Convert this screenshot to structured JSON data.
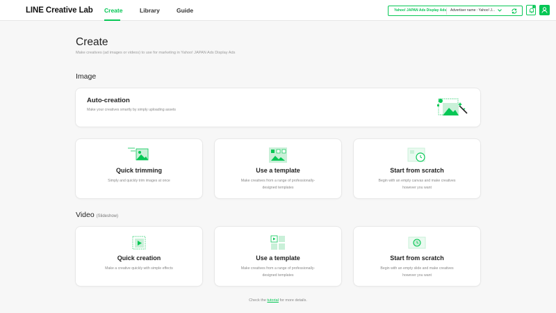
{
  "header": {
    "logo": "LINE Creative Lab",
    "nav": [
      "Create",
      "Library",
      "Guide"
    ],
    "account_ads": "Yahoo! JAPAN Ads Display Ads",
    "advertiser": "Advertiser name : Yahoo! J..."
  },
  "page": {
    "title": "Create",
    "description": "Make creatives (ad images or videos) to use for marketing in Yahoo! JAPAN Ads Display Ads"
  },
  "image_section": {
    "title": "Image",
    "auto": {
      "title": "Auto-creation",
      "desc": "Make your creatives smartly by simply uploading assets"
    },
    "cards": [
      {
        "title": "Quick trimming",
        "desc": "Simply and quickly trim images at once"
      },
      {
        "title": "Use a template",
        "desc": "Make creatives from a range of professionally-designed templates"
      },
      {
        "title": "Start from scratch",
        "desc": "Begin with an empty canvas and make creatives however you want"
      }
    ]
  },
  "video_section": {
    "title": "Video",
    "subtitle": "(Slideshow)",
    "cards": [
      {
        "title": "Quick creation",
        "desc": "Make a creative quickly with simple effects"
      },
      {
        "title": "Use a template",
        "desc": "Make creatives from a range of professionally-designed templates"
      },
      {
        "title": "Start from scratch",
        "desc": "Begin with an empty slide and make creatives however you want"
      }
    ]
  },
  "footer": {
    "before": "Check the ",
    "link": "tutorial",
    "after": " for more details."
  },
  "colors": {
    "accent": "#06c755",
    "accent_light": "#c9f0d8"
  }
}
